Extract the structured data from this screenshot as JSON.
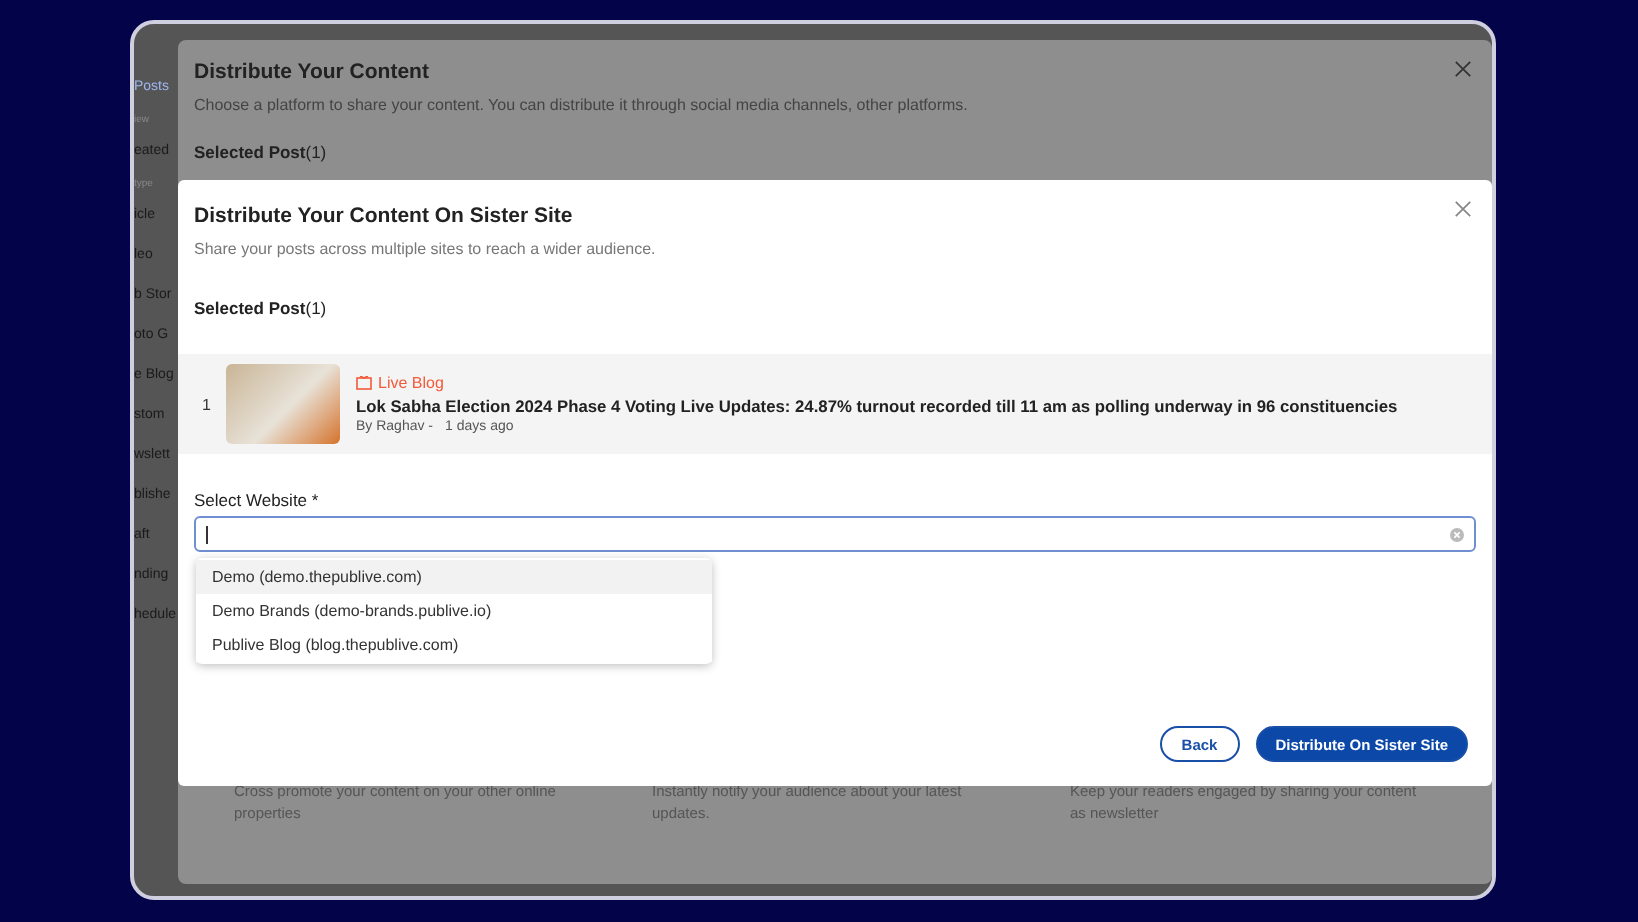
{
  "app_sidebar": {
    "items": [
      {
        "label": "Posts",
        "kind": "link"
      },
      {
        "label": "iew",
        "kind": "heading"
      },
      {
        "label": "eated",
        "kind": "item"
      },
      {
        "label": "type",
        "kind": "heading"
      },
      {
        "label": "icle",
        "kind": "item"
      },
      {
        "label": "leo",
        "kind": "item"
      },
      {
        "label": "b Stor",
        "kind": "item"
      },
      {
        "label": "oto G",
        "kind": "item"
      },
      {
        "label": "e Blog",
        "kind": "item"
      },
      {
        "label": "stom",
        "kind": "item"
      },
      {
        "label": "wslett",
        "kind": "item"
      },
      {
        "label": "blishe",
        "kind": "item"
      },
      {
        "label": "aft",
        "kind": "item"
      },
      {
        "label": "nding",
        "kind": "item"
      },
      {
        "label": "hedule",
        "kind": "item"
      }
    ]
  },
  "background_dialog": {
    "title": "Distribute Your Content",
    "description": "Choose a platform to share your content. You can distribute it through social media channels, other platforms.",
    "selected_post_label": "Selected Post",
    "selected_post_count": "(1)",
    "cards": [
      {
        "description": "Cross promote your content on your other online properties"
      },
      {
        "description": "Instantly notify your audience about your latest updates."
      },
      {
        "description": "Keep your readers engaged by sharing your content as newsletter"
      }
    ]
  },
  "dialog": {
    "title": "Distribute Your Content On Sister Site",
    "description": "Share your posts across multiple sites to reach a wider audience.",
    "selected_post_label": "Selected Post",
    "selected_post_count": "(1)",
    "posts": [
      {
        "index": "1",
        "tag": "Live Blog",
        "title": "Lok Sabha Election 2024 Phase 4 Voting Live Updates: 24.87% turnout recorded till 11 am as polling underway in 96 constituencies",
        "author": "By Raghav -",
        "time": "1 days ago"
      }
    ],
    "website_field": {
      "label": "Select Website *",
      "focused": true,
      "options": [
        {
          "label": "Demo (demo.thepublive.com)",
          "selected": true
        },
        {
          "label": "Demo Brands (demo-brands.publive.io)",
          "selected": false
        },
        {
          "label": "Publive Blog (blog.thepublive.com)",
          "selected": false
        }
      ]
    },
    "buttons": [
      {
        "label": "Back",
        "kind": "secondary"
      },
      {
        "label": "Distribute On Sister Site",
        "kind": "primary"
      }
    ]
  }
}
